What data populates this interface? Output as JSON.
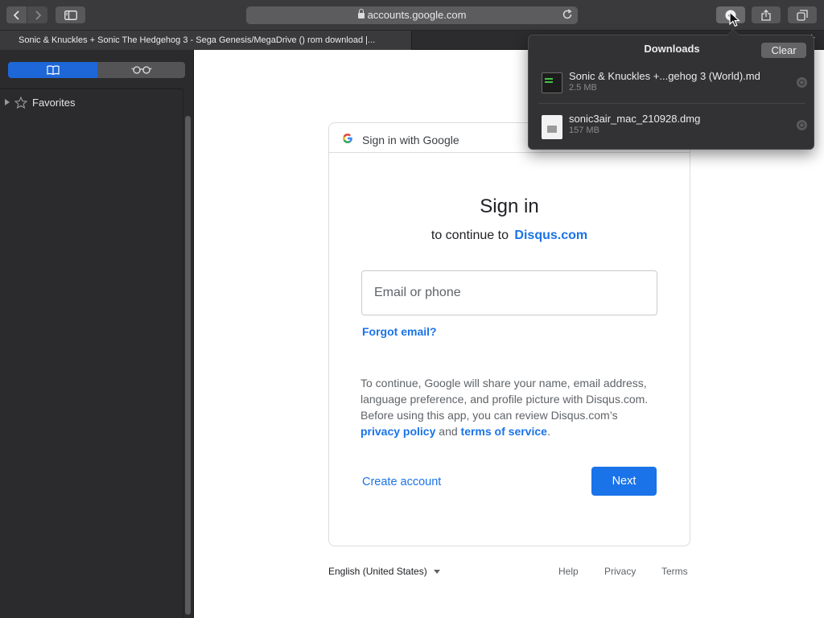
{
  "browser": {
    "address": "accounts.google.com",
    "active_tab_title": "Sonic & Knuckles + Sonic The Hedgehog 3 - Sega Genesis/MegaDrive () rom download |..."
  },
  "sidebar": {
    "favorites_label": "Favorites"
  },
  "downloads": {
    "title": "Downloads",
    "clear_label": "Clear",
    "items": [
      {
        "name": "Sonic & Knuckles +...gehog 3 (World).md",
        "size": "2.5 MB",
        "icon": "terminal-file-icon"
      },
      {
        "name": "sonic3air_mac_210928.dmg",
        "size": "157 MB",
        "icon": "disk-image-icon"
      }
    ]
  },
  "signin": {
    "header": "Sign in with Google",
    "title": "Sign in",
    "subtitle_prefix": "to continue to",
    "subtitle_site": "Disqus.com",
    "email_placeholder": "Email or phone",
    "forgot_email": "Forgot email?",
    "consent_text": "To continue, Google will share your name, email address, language preference, and profile picture with Disqus.com. Before using this app, you can review Disqus.com’s",
    "privacy_policy": "privacy policy",
    "and": "and",
    "terms_of_service": "terms of service",
    "period": ".",
    "create_account": "Create account",
    "next": "Next"
  },
  "footer": {
    "language": "English (United States)",
    "help": "Help",
    "privacy": "Privacy",
    "terms": "Terms"
  },
  "colors": {
    "google_blue": "#1a73e8",
    "sidebar_selected": "#1d67d8",
    "toolbar_bg": "#3a3a3c"
  }
}
